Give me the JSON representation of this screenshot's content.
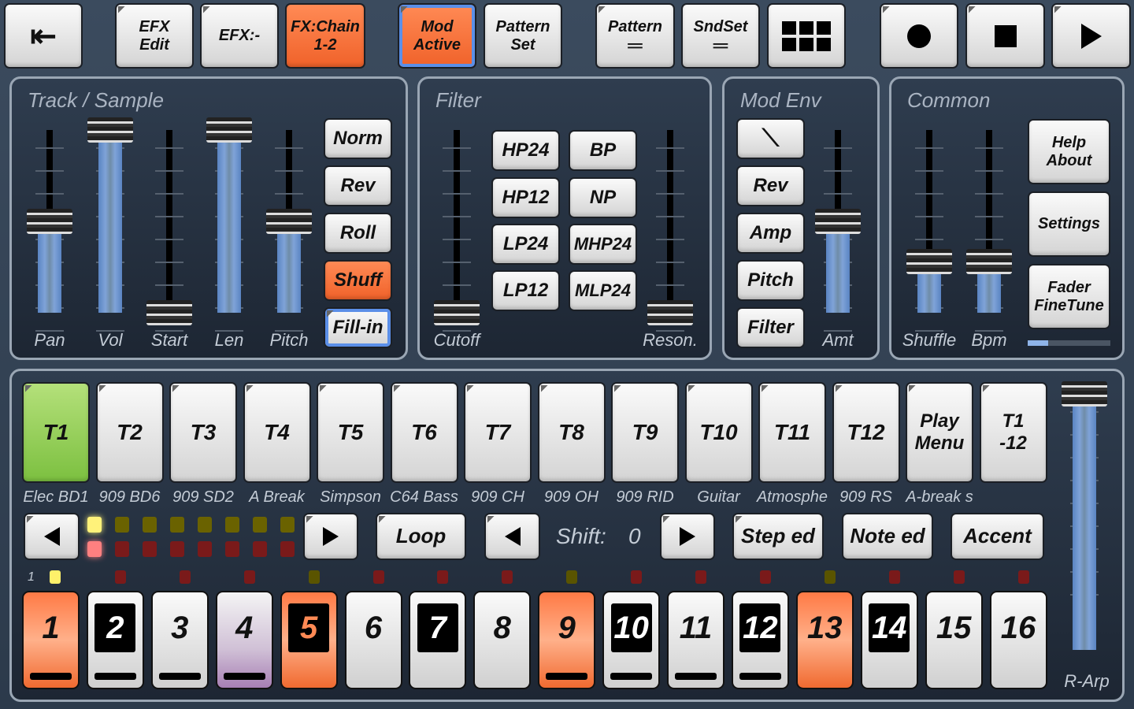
{
  "toolbar": {
    "exit": "exit-icon",
    "efx_edit": "EFX\nEdit",
    "efx": "EFX:-",
    "fx_chain": "FX:Chain\n1-2",
    "mod_active": "Mod\nActive",
    "pattern_set": "Pattern\nSet",
    "pattern": "Pattern",
    "sndset": "SndSet"
  },
  "track_sample": {
    "title": "Track / Sample",
    "faders": [
      {
        "label": "Pan",
        "value": 0.5
      },
      {
        "label": "Vol",
        "value": 1.0
      },
      {
        "label": "Start",
        "value": 0.0
      },
      {
        "label": "Len",
        "value": 1.0
      },
      {
        "label": "Pitch",
        "value": 0.5
      }
    ],
    "buttons": [
      "Norm",
      "Rev",
      "Roll",
      "Shuff",
      "Fill-in"
    ]
  },
  "filter": {
    "title": "Filter",
    "cutoff": {
      "label": "Cutoff",
      "value": 0.0
    },
    "reson": {
      "label": "Reson.",
      "value": 0.0
    },
    "buttons": [
      "HP24",
      "BP",
      "HP12",
      "NP",
      "LP24",
      "MHP24",
      "LP12",
      "MLP24"
    ]
  },
  "mod_env": {
    "title": "Mod Env",
    "buttons": [
      "Rev",
      "Amp",
      "Pitch",
      "Filter"
    ],
    "amt": {
      "label": "Amt",
      "value": 0.5
    }
  },
  "common": {
    "title": "Common",
    "shuffle": {
      "label": "Shuffle",
      "value": 0.28
    },
    "bpm": {
      "label": "Bpm",
      "value": 0.28
    },
    "buttons": [
      "Help\nAbout",
      "Settings",
      "Fader\nFineTune"
    ],
    "progress": 0.25
  },
  "tracks": [
    {
      "label": "T1",
      "name": "Elec BD1"
    },
    {
      "label": "T2",
      "name": "909 BD6"
    },
    {
      "label": "T3",
      "name": "909 SD2"
    },
    {
      "label": "T4",
      "name": "A Break"
    },
    {
      "label": "T5",
      "name": "Simpson"
    },
    {
      "label": "T6",
      "name": "C64 Bass"
    },
    {
      "label": "T7",
      "name": "909 CH"
    },
    {
      "label": "T8",
      "name": "909 OH"
    },
    {
      "label": "T9",
      "name": "909 RID"
    },
    {
      "label": "T10",
      "name": "Guitar"
    },
    {
      "label": "T11",
      "name": "Atmosphe"
    },
    {
      "label": "T12",
      "name": "909 RS"
    },
    {
      "label": "Play\nMenu",
      "name": "A-break s"
    },
    {
      "label": "T1\n-12",
      "name": ""
    }
  ],
  "controls": {
    "loop": "Loop",
    "shift_label": "Shift:",
    "shift_value": "0",
    "step_ed": "Step ed",
    "note_ed": "Note ed",
    "accent": "Accent",
    "page_label": "1"
  },
  "rarp": {
    "label": "R-Arp",
    "value": 1.0
  },
  "steps": [
    {
      "n": "1",
      "s": "orange",
      "bar": true,
      "led": "yellow"
    },
    {
      "n": "2",
      "s": "black",
      "bar": true,
      "led": "red"
    },
    {
      "n": "3",
      "s": "white",
      "bar": true,
      "led": "red"
    },
    {
      "n": "4",
      "s": "purple",
      "bar": true,
      "led": "red"
    },
    {
      "n": "5",
      "s": "orange-black",
      "bar": false,
      "led": "olive"
    },
    {
      "n": "6",
      "s": "white",
      "bar": false,
      "led": "red"
    },
    {
      "n": "7",
      "s": "black",
      "bar": false,
      "led": "red"
    },
    {
      "n": "8",
      "s": "white",
      "bar": false,
      "led": "red"
    },
    {
      "n": "9",
      "s": "orange",
      "bar": true,
      "led": "olive"
    },
    {
      "n": "10",
      "s": "black",
      "bar": true,
      "led": "red"
    },
    {
      "n": "11",
      "s": "white",
      "bar": true,
      "led": "red"
    },
    {
      "n": "12",
      "s": "black",
      "bar": true,
      "led": "red"
    },
    {
      "n": "13",
      "s": "orange",
      "bar": false,
      "led": "olive"
    },
    {
      "n": "14",
      "s": "black",
      "bar": false,
      "led": "red"
    },
    {
      "n": "15",
      "s": "white",
      "bar": false,
      "led": "red"
    },
    {
      "n": "16",
      "s": "white",
      "bar": false,
      "led": "red"
    }
  ]
}
